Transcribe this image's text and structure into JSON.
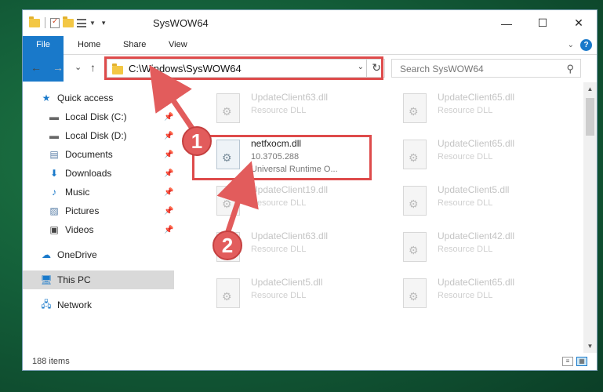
{
  "window": {
    "title": "SysWOW64",
    "buttons": {
      "minimize": "—",
      "maximize": "☐",
      "close": "✕"
    }
  },
  "ribbon": {
    "tabs": [
      "File",
      "Home",
      "Share",
      "View"
    ],
    "help": "?"
  },
  "navigation": {
    "back": "←",
    "forward": "→",
    "recent": "⌄",
    "up": "↑",
    "address_path": "C:\\Windows\\SysWOW64",
    "search_placeholder": "Search SysWOW64"
  },
  "sidebar": {
    "items": [
      {
        "label": "Quick access",
        "icon": "star-icon"
      },
      {
        "label": "Local Disk (C:)",
        "icon": "drive-icon",
        "pinned": true
      },
      {
        "label": "Local Disk (D:)",
        "icon": "drive-icon",
        "pinned": true
      },
      {
        "label": "Documents",
        "icon": "documents-icon",
        "pinned": true
      },
      {
        "label": "Downloads",
        "icon": "downloads-icon",
        "pinned": true
      },
      {
        "label": "Music",
        "icon": "music-icon",
        "pinned": true
      },
      {
        "label": "Pictures",
        "icon": "pictures-icon",
        "pinned": true
      },
      {
        "label": "Videos",
        "icon": "videos-icon",
        "pinned": true
      },
      {
        "label": "OneDrive",
        "icon": "cloud-icon"
      },
      {
        "label": "This PC",
        "icon": "computer-icon",
        "selected": true
      },
      {
        "label": "Network",
        "icon": "network-icon"
      }
    ]
  },
  "files": [
    {
      "name": "UpdateClient63.dll",
      "type": "Resource DLL"
    },
    {
      "name": "UpdateClient65.dll",
      "type": "Resource DLL"
    },
    {
      "name": "netfxocm.dll",
      "version": "10.3705.288",
      "description": "Universal Runtime O...",
      "highlighted": true
    },
    {
      "name": "UpdateClient65.dll",
      "type": "Resource DLL"
    },
    {
      "name": "UpdateClient19.dll",
      "type": "Resource DLL"
    },
    {
      "name": "UpdateClient5.dll",
      "type": "Resource DLL"
    },
    {
      "name": "UpdateClient63.dll",
      "type": "Resource DLL"
    },
    {
      "name": "UpdateClient42.dll",
      "type": "Resource DLL"
    },
    {
      "name": "UpdateClient5.dll",
      "type": "Resource DLL"
    },
    {
      "name": "UpdateClient65.dll",
      "type": "Resource DLL"
    }
  ],
  "status": {
    "item_count": "188 items"
  },
  "annotations": {
    "step1": "1",
    "step2": "2",
    "color": "#de4b4b"
  }
}
